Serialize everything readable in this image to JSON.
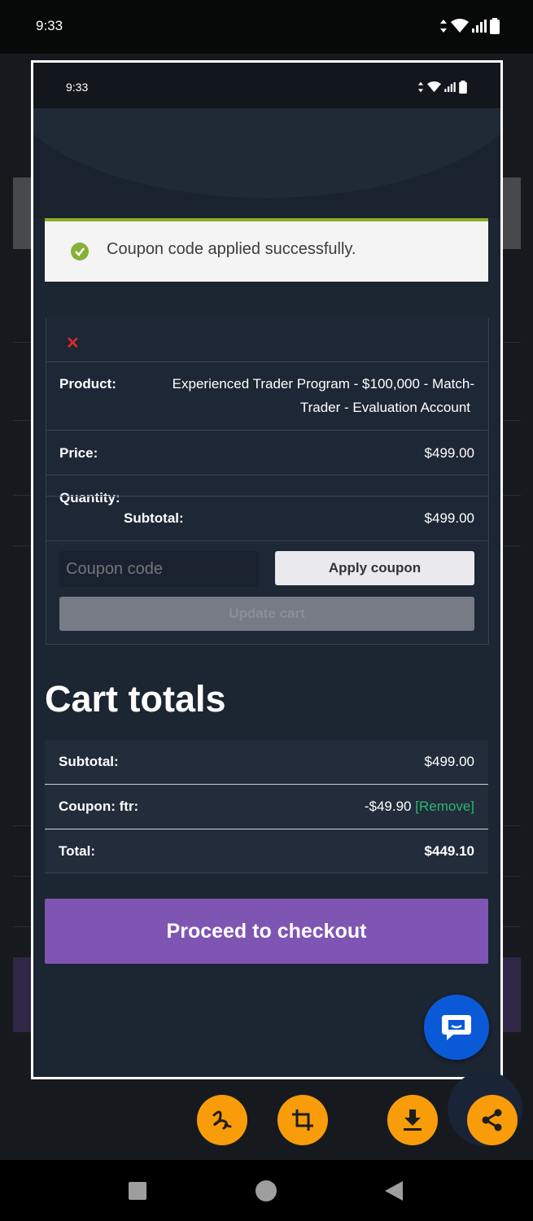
{
  "system": {
    "time": "9:33"
  },
  "screenshot": {
    "time": "9:33",
    "notice": "Coupon code applied successfully.",
    "cart": {
      "product_label": "Product:",
      "product_line1": "Experienced Trader Program - $100,000 - Match-",
      "product_line2": "Trader - Evaluation Account",
      "price_label": "Price:",
      "price_value": "$499.00",
      "quantity_label": "Quantity:",
      "subtotal_label": "Subtotal:",
      "subtotal_value": "$499.00",
      "coupon_placeholder": "Coupon code",
      "apply_label": "Apply coupon",
      "update_label": "Update cart"
    },
    "totals": {
      "title": "Cart totals",
      "subtotal_label": "Subtotal:",
      "subtotal_value": "$499.00",
      "coupon_label": "Coupon: ftr:",
      "coupon_value": "-$49.90",
      "remove_label": "[Remove]",
      "total_label": "Total:",
      "total_value": "$449.10"
    },
    "checkout_label": "Proceed to checkout"
  },
  "icons": {
    "remove_item": "close-icon",
    "notice": "check-circle-icon",
    "chat": "chat-bubble-icon",
    "toolbar": [
      "scribble-icon",
      "crop-icon",
      "download-icon",
      "share-icon"
    ],
    "nav": [
      "recents-icon",
      "home-icon",
      "back-icon"
    ]
  },
  "colors": {
    "accent_green": "#8aab27",
    "checkout_purple": "#7f55b4",
    "action_orange": "#f99c0a",
    "remove_green": "#2bb673",
    "chat_blue": "#0a5ad8"
  }
}
